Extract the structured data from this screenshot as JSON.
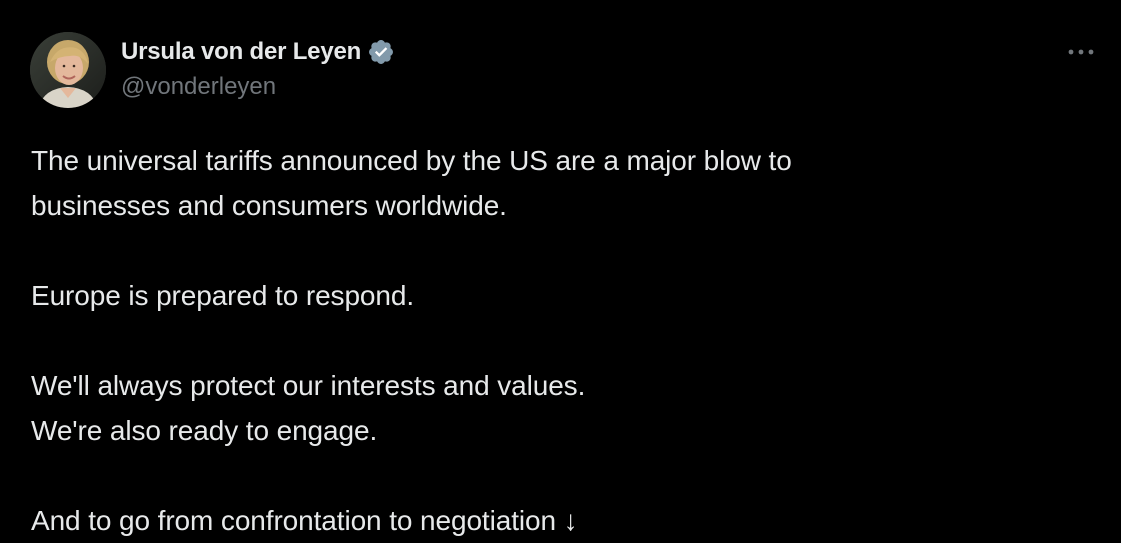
{
  "tweet": {
    "author": {
      "display_name": "Ursula von der Leyen",
      "handle": "@vonderleyen",
      "verified_icon": "verified-badge-icon",
      "avatar": "avatar-photo"
    },
    "more_icon": "more-options-icon",
    "text": {
      "line1": "The universal tariffs announced by the US are a major blow to",
      "line2": "businesses and consumers worldwide.",
      "line3": "Europe is prepared to respond.",
      "line4": "We'll always protect our interests and values.",
      "line5": "We're also ready to engage.",
      "line6": "And to go from confrontation to negotiation ↓"
    }
  },
  "colors": {
    "background": "#000000",
    "primary_text": "#e7e9ea",
    "secondary_text": "#71767b",
    "verified_badge": "#829aab"
  }
}
